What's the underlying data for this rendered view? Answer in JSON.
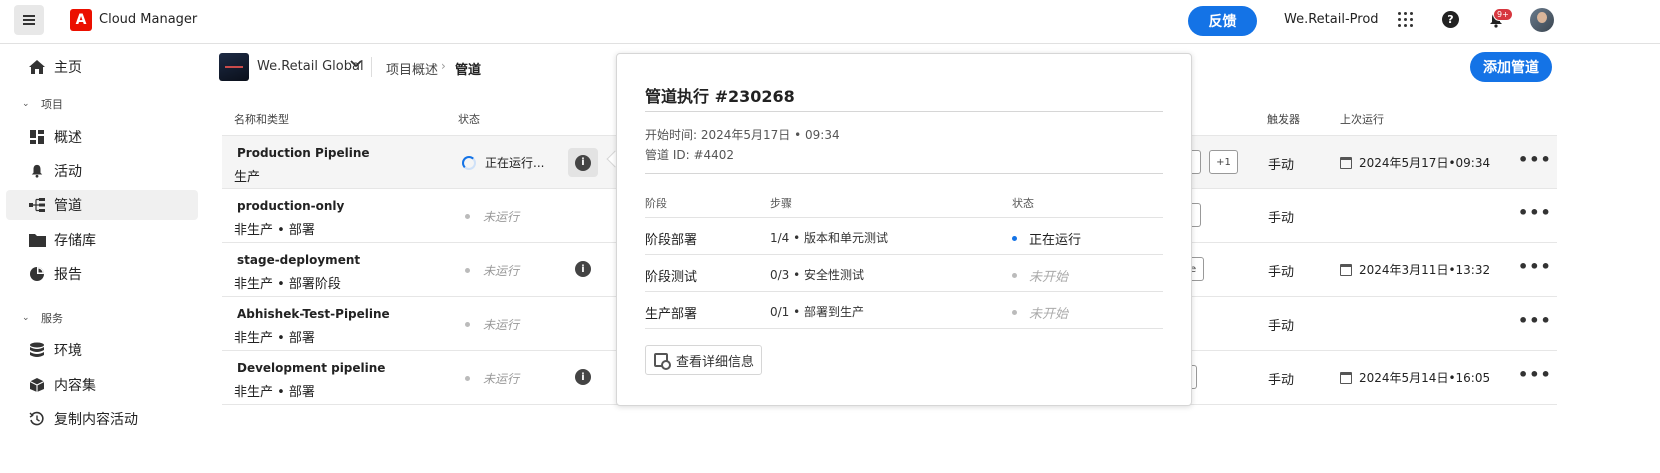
{
  "topbar": {
    "app_title": "Cloud Manager",
    "logo_letter": "A",
    "feedback_label": "反馈",
    "org_name": "We.Retail-Prod",
    "help_glyph": "?",
    "notification_badge": "9+"
  },
  "sidebar": {
    "home": "主页",
    "projects_section": "项目",
    "overview": "概述",
    "activity": "活动",
    "pipelines": "管道",
    "repositories": "存储库",
    "reports": "报告",
    "services_section": "服务",
    "environments": "环境",
    "content_sets": "内容集",
    "copy_content": "复制内容活动"
  },
  "header": {
    "project_name": "We.Retail Global",
    "breadcrumb_overview": "项目概述",
    "breadcrumb_separator": "›",
    "breadcrumb_current": "管道",
    "add_pipeline_label": "添加管道"
  },
  "table": {
    "columns": {
      "name_type": "名称和类型",
      "status": "状态",
      "trigger": "触发器",
      "last_run": "上次运行"
    },
    "rows": [
      {
        "name": "Production Pipeline",
        "type": "生产",
        "status": "正在运行...",
        "trigger": "手动",
        "last_run": "2024年5月17日•09:34",
        "chip": "+1"
      },
      {
        "name": "production-only",
        "type": "非生产 • 部署",
        "status": "未运行",
        "trigger": "手动",
        "last_run": ""
      },
      {
        "name": "stage-deployment",
        "type": "非生产 • 部署阶段",
        "status": "未运行",
        "trigger": "手动",
        "last_run": "2024年3月11日•13:32",
        "chip": "e"
      },
      {
        "name": "Abhishek-Test-Pipeline",
        "type": "非生产 • 部署",
        "status": "未运行",
        "trigger": "手动",
        "last_run": ""
      },
      {
        "name": "Development pipeline",
        "type": "非生产 • 部署",
        "status": "未运行",
        "trigger": "手动",
        "last_run": "2024年5月14日•16:05"
      }
    ]
  },
  "popover": {
    "title": "管道执行 #230268",
    "start_time": "开始时间: 2024年5月17日 • 09:34",
    "pipeline_id": "管道 ID: #4402",
    "col_stage": "阶段",
    "col_step": "步骤",
    "col_status": "状态",
    "stages": [
      {
        "stage": "阶段部署",
        "step": "1/4 • 版本和单元测试",
        "status": "正在运行"
      },
      {
        "stage": "阶段测试",
        "step": "0/3 • 安全性测试",
        "status": "未开始"
      },
      {
        "stage": "生产部署",
        "step": "0/1 • 部署到生产",
        "status": "未开始"
      }
    ],
    "details_label": "查看详细信息"
  },
  "colors": {
    "accent": "#1473e6",
    "brand": "#eb1000"
  }
}
